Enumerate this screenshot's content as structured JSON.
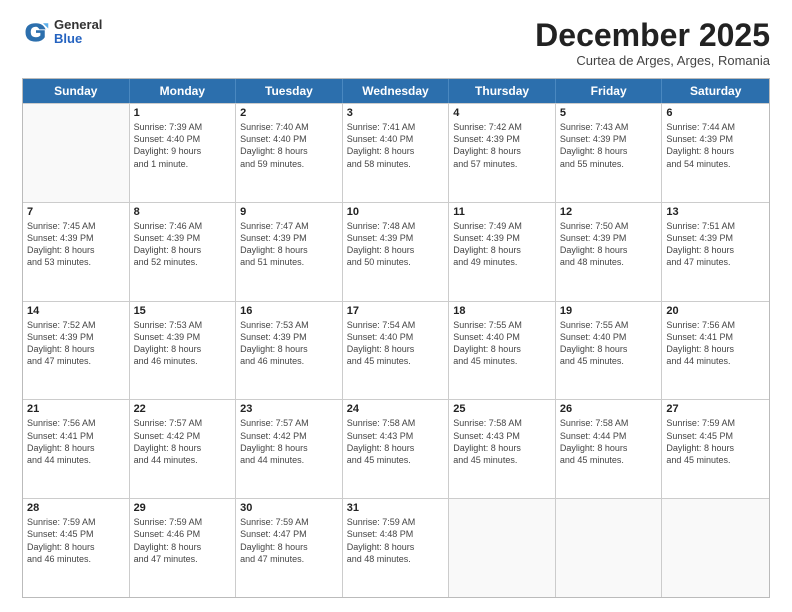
{
  "header": {
    "logo_general": "General",
    "logo_blue": "Blue",
    "month_title": "December 2025",
    "subtitle": "Curtea de Arges, Arges, Romania"
  },
  "days_of_week": [
    "Sunday",
    "Monday",
    "Tuesday",
    "Wednesday",
    "Thursday",
    "Friday",
    "Saturday"
  ],
  "weeks": [
    [
      {
        "day": "",
        "info": []
      },
      {
        "day": "1",
        "info": [
          "Sunrise: 7:39 AM",
          "Sunset: 4:40 PM",
          "Daylight: 9 hours",
          "and 1 minute."
        ]
      },
      {
        "day": "2",
        "info": [
          "Sunrise: 7:40 AM",
          "Sunset: 4:40 PM",
          "Daylight: 8 hours",
          "and 59 minutes."
        ]
      },
      {
        "day": "3",
        "info": [
          "Sunrise: 7:41 AM",
          "Sunset: 4:40 PM",
          "Daylight: 8 hours",
          "and 58 minutes."
        ]
      },
      {
        "day": "4",
        "info": [
          "Sunrise: 7:42 AM",
          "Sunset: 4:39 PM",
          "Daylight: 8 hours",
          "and 57 minutes."
        ]
      },
      {
        "day": "5",
        "info": [
          "Sunrise: 7:43 AM",
          "Sunset: 4:39 PM",
          "Daylight: 8 hours",
          "and 55 minutes."
        ]
      },
      {
        "day": "6",
        "info": [
          "Sunrise: 7:44 AM",
          "Sunset: 4:39 PM",
          "Daylight: 8 hours",
          "and 54 minutes."
        ]
      }
    ],
    [
      {
        "day": "7",
        "info": [
          "Sunrise: 7:45 AM",
          "Sunset: 4:39 PM",
          "Daylight: 8 hours",
          "and 53 minutes."
        ]
      },
      {
        "day": "8",
        "info": [
          "Sunrise: 7:46 AM",
          "Sunset: 4:39 PM",
          "Daylight: 8 hours",
          "and 52 minutes."
        ]
      },
      {
        "day": "9",
        "info": [
          "Sunrise: 7:47 AM",
          "Sunset: 4:39 PM",
          "Daylight: 8 hours",
          "and 51 minutes."
        ]
      },
      {
        "day": "10",
        "info": [
          "Sunrise: 7:48 AM",
          "Sunset: 4:39 PM",
          "Daylight: 8 hours",
          "and 50 minutes."
        ]
      },
      {
        "day": "11",
        "info": [
          "Sunrise: 7:49 AM",
          "Sunset: 4:39 PM",
          "Daylight: 8 hours",
          "and 49 minutes."
        ]
      },
      {
        "day": "12",
        "info": [
          "Sunrise: 7:50 AM",
          "Sunset: 4:39 PM",
          "Daylight: 8 hours",
          "and 48 minutes."
        ]
      },
      {
        "day": "13",
        "info": [
          "Sunrise: 7:51 AM",
          "Sunset: 4:39 PM",
          "Daylight: 8 hours",
          "and 47 minutes."
        ]
      }
    ],
    [
      {
        "day": "14",
        "info": [
          "Sunrise: 7:52 AM",
          "Sunset: 4:39 PM",
          "Daylight: 8 hours",
          "and 47 minutes."
        ]
      },
      {
        "day": "15",
        "info": [
          "Sunrise: 7:53 AM",
          "Sunset: 4:39 PM",
          "Daylight: 8 hours",
          "and 46 minutes."
        ]
      },
      {
        "day": "16",
        "info": [
          "Sunrise: 7:53 AM",
          "Sunset: 4:39 PM",
          "Daylight: 8 hours",
          "and 46 minutes."
        ]
      },
      {
        "day": "17",
        "info": [
          "Sunrise: 7:54 AM",
          "Sunset: 4:40 PM",
          "Daylight: 8 hours",
          "and 45 minutes."
        ]
      },
      {
        "day": "18",
        "info": [
          "Sunrise: 7:55 AM",
          "Sunset: 4:40 PM",
          "Daylight: 8 hours",
          "and 45 minutes."
        ]
      },
      {
        "day": "19",
        "info": [
          "Sunrise: 7:55 AM",
          "Sunset: 4:40 PM",
          "Daylight: 8 hours",
          "and 45 minutes."
        ]
      },
      {
        "day": "20",
        "info": [
          "Sunrise: 7:56 AM",
          "Sunset: 4:41 PM",
          "Daylight: 8 hours",
          "and 44 minutes."
        ]
      }
    ],
    [
      {
        "day": "21",
        "info": [
          "Sunrise: 7:56 AM",
          "Sunset: 4:41 PM",
          "Daylight: 8 hours",
          "and 44 minutes."
        ]
      },
      {
        "day": "22",
        "info": [
          "Sunrise: 7:57 AM",
          "Sunset: 4:42 PM",
          "Daylight: 8 hours",
          "and 44 minutes."
        ]
      },
      {
        "day": "23",
        "info": [
          "Sunrise: 7:57 AM",
          "Sunset: 4:42 PM",
          "Daylight: 8 hours",
          "and 44 minutes."
        ]
      },
      {
        "day": "24",
        "info": [
          "Sunrise: 7:58 AM",
          "Sunset: 4:43 PM",
          "Daylight: 8 hours",
          "and 45 minutes."
        ]
      },
      {
        "day": "25",
        "info": [
          "Sunrise: 7:58 AM",
          "Sunset: 4:43 PM",
          "Daylight: 8 hours",
          "and 45 minutes."
        ]
      },
      {
        "day": "26",
        "info": [
          "Sunrise: 7:58 AM",
          "Sunset: 4:44 PM",
          "Daylight: 8 hours",
          "and 45 minutes."
        ]
      },
      {
        "day": "27",
        "info": [
          "Sunrise: 7:59 AM",
          "Sunset: 4:45 PM",
          "Daylight: 8 hours",
          "and 45 minutes."
        ]
      }
    ],
    [
      {
        "day": "28",
        "info": [
          "Sunrise: 7:59 AM",
          "Sunset: 4:45 PM",
          "Daylight: 8 hours",
          "and 46 minutes."
        ]
      },
      {
        "day": "29",
        "info": [
          "Sunrise: 7:59 AM",
          "Sunset: 4:46 PM",
          "Daylight: 8 hours",
          "and 47 minutes."
        ]
      },
      {
        "day": "30",
        "info": [
          "Sunrise: 7:59 AM",
          "Sunset: 4:47 PM",
          "Daylight: 8 hours",
          "and 47 minutes."
        ]
      },
      {
        "day": "31",
        "info": [
          "Sunrise: 7:59 AM",
          "Sunset: 4:48 PM",
          "Daylight: 8 hours",
          "and 48 minutes."
        ]
      },
      {
        "day": "",
        "info": []
      },
      {
        "day": "",
        "info": []
      },
      {
        "day": "",
        "info": []
      }
    ]
  ]
}
